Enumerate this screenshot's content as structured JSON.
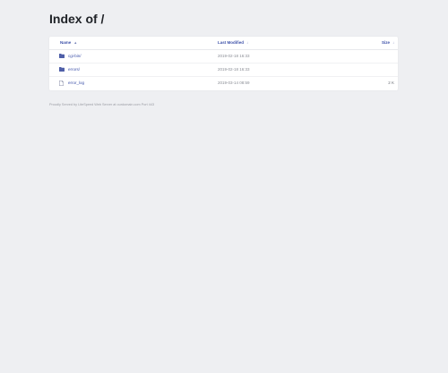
{
  "page": {
    "title": "Index of /"
  },
  "table": {
    "headers": {
      "name": "Name",
      "modified": "Last Modified",
      "size": "Size"
    },
    "sort_indicators": {
      "name": "▲",
      "modified": "↓",
      "size": "↓"
    },
    "rows": [
      {
        "type": "folder",
        "icon": "folder-icon",
        "name": "cgi-bin/",
        "modified": "2019-02-18 16:33",
        "size": ""
      },
      {
        "type": "folder",
        "icon": "folder-icon",
        "name": "errors/",
        "modified": "2019-02-18 16:33",
        "size": ""
      },
      {
        "type": "file",
        "icon": "file-icon",
        "name": "error_log",
        "modified": "2019-03-14 08:59",
        "size": "2 K"
      }
    ]
  },
  "footer": {
    "text": "Proudly Served by LiteSpeed Web Server at ourdomain.com Port 443"
  },
  "colors": {
    "background": "#eeeff2",
    "link": "#3b4fa8",
    "folder_icon": "#4f5fa8"
  }
}
